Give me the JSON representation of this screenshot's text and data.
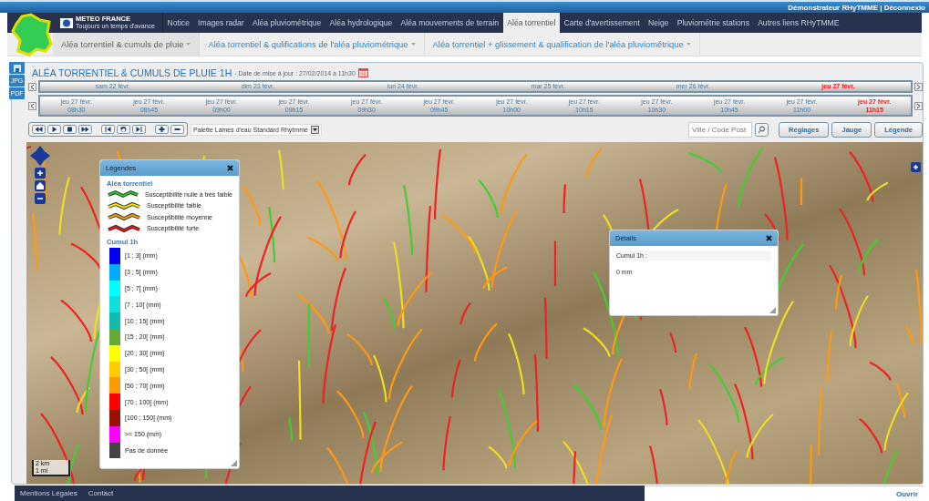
{
  "top_bar": {
    "user_links": "Démonstrateur RHyTMME | Déconnexio"
  },
  "logo": {
    "name": "METEO FRANCE",
    "slogan": "Toujours un temps d'avance"
  },
  "nav_tabs": [
    {
      "label": "Notice",
      "selected": false
    },
    {
      "label": "Images radar",
      "selected": false
    },
    {
      "label": "Aléa pluviométrique",
      "selected": false
    },
    {
      "label": "Aléa hydrologique",
      "selected": false
    },
    {
      "label": "Aléa mouvements de terrain",
      "selected": false
    },
    {
      "label": "Aléa torrentiel",
      "selected": true
    },
    {
      "label": "Carte d'avertissement",
      "selected": false
    },
    {
      "label": "Neige",
      "selected": false
    },
    {
      "label": "Pluviométrie stations",
      "selected": false
    },
    {
      "label": "Autres liens RHyTMME",
      "selected": false
    }
  ],
  "sub_tabs": [
    {
      "label": "Aléa torrentiel & cumuls de pluie",
      "selected": true
    },
    {
      "label": "Aléa torrentiel & qulifications de l'aléa pluviométrique",
      "selected": false
    },
    {
      "label": "Aléa torrentiel + glissement & qualification de l'aléa pluviométrique",
      "selected": false
    }
  ],
  "export": [
    "JPG",
    "PDF"
  ],
  "title": "ALÉA TORRENTIEL & CUMULS DE PLUIE 1H",
  "update_date": "- Date de mise à jour : 27/02/2014 à 11h30",
  "days": [
    {
      "label": "sam 22 févr.",
      "selected": false
    },
    {
      "label": "dim 23 févr.",
      "selected": false
    },
    {
      "label": "lun 24 févr.",
      "selected": false
    },
    {
      "label": "mar 25 févr.",
      "selected": false
    },
    {
      "label": "mer 26 févr.",
      "selected": false
    },
    {
      "label": "jeu 27 févr.",
      "selected": true
    }
  ],
  "times": [
    {
      "day": "jeu 27 févr.",
      "time": "08h30",
      "selected": false
    },
    {
      "day": "jeu 27 févr.",
      "time": "08h45",
      "selected": false
    },
    {
      "day": "jeu 27 févr.",
      "time": "09h00",
      "selected": false
    },
    {
      "day": "jeu 27 févr.",
      "time": "09h15",
      "selected": false
    },
    {
      "day": "jeu 27 févr.",
      "time": "09h30",
      "selected": false
    },
    {
      "day": "jeu 27 févr.",
      "time": "09h45",
      "selected": false
    },
    {
      "day": "jeu 27 févr.",
      "time": "10h00",
      "selected": false
    },
    {
      "day": "jeu 27 févr.",
      "time": "10h15",
      "selected": false
    },
    {
      "day": "jeu 27 févr.",
      "time": "10h30",
      "selected": false
    },
    {
      "day": "jeu 27 févr.",
      "time": "10h45",
      "selected": false
    },
    {
      "day": "jeu 27 févr.",
      "time": "11h00",
      "selected": false
    },
    {
      "day": "jeu 27 févr.",
      "time": "11h15",
      "selected": true
    }
  ],
  "palette": {
    "value": "Palette Lames d'eau Standard Rhytmme"
  },
  "search": {
    "placeholder": "Ville / Code Post"
  },
  "buttons": [
    "Réglages",
    "Jauge",
    "Légende"
  ],
  "legend": {
    "title": "Légendes",
    "torrent_title": "Aléa torrentiel",
    "torrent_items": [
      {
        "label": "Susceptibilité nulle à très faible",
        "color": "#22cc22"
      },
      {
        "label": "Susceptibilité faible",
        "color": "#eeee00"
      },
      {
        "label": "Susceptibilité moyenne",
        "color": "#ff9900"
      },
      {
        "label": "Susceptibilité forte",
        "color": "#ee1111"
      }
    ],
    "cumul_title": "Cumul 1h",
    "cumul_items": [
      {
        "label": "[1 ; 3[ (mm)",
        "color": "#0000ee"
      },
      {
        "label": "[3 ; 5[ (mm)",
        "color": "#00aaff"
      },
      {
        "label": "[5 ; 7[ (mm)",
        "color": "#00ffff"
      },
      {
        "label": "[7 ; 10[ (mm)",
        "color": "#11dddd"
      },
      {
        "label": "[10 ; 15[ (mm)",
        "color": "#11bbaa"
      },
      {
        "label": "[15 ; 20[ (mm)",
        "color": "#66aa33"
      },
      {
        "label": "[20 ; 30[ (mm)",
        "color": "#ffff00"
      },
      {
        "label": "[30 ; 50[ (mm)",
        "color": "#ffcc00"
      },
      {
        "label": "[50 ; 70[ (mm)",
        "color": "#ff9900"
      },
      {
        "label": "[70 ; 100[ (mm)",
        "color": "#ff0000"
      },
      {
        "label": "[100 ; 150[ (mm)",
        "color": "#991100"
      },
      {
        "label": ">= 150 (mm)",
        "color": "#ff00ff"
      },
      {
        "label": "Pas de donnée",
        "color": "#444444"
      }
    ]
  },
  "details": {
    "title": "Détails",
    "label": "Cumul 1h :",
    "value": "0 mm"
  },
  "scale": {
    "metric": "2 km",
    "imperial": "1 mi"
  },
  "footer": {
    "links": [
      "Mentions Légales",
      "Contact"
    ],
    "open": "Ouvrir"
  }
}
